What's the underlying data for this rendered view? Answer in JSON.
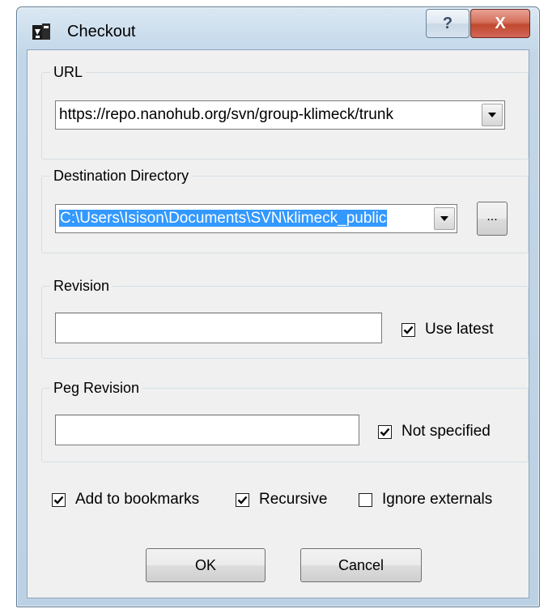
{
  "window": {
    "title": "Checkout",
    "help_label": "?",
    "close_label": "X"
  },
  "url_group": {
    "legend": "URL",
    "value": "https://repo.nanohub.org/svn/group-klimeck/trunk"
  },
  "destination_group": {
    "legend": "Destination Directory",
    "value": "C:\\Users\\Isison\\Documents\\SVN\\klimeck_public",
    "browse_label": "..."
  },
  "revision_group": {
    "legend": "Revision",
    "value": "",
    "use_latest_label": "Use latest",
    "use_latest_checked": true
  },
  "peg_revision_group": {
    "legend": "Peg Revision",
    "value": "",
    "not_specified_label": "Not specified",
    "not_specified_checked": true
  },
  "options": {
    "add_to_bookmarks_label": "Add to bookmarks",
    "add_to_bookmarks_checked": true,
    "recursive_label": "Recursive",
    "recursive_checked": true,
    "ignore_externals_label": "Ignore externals",
    "ignore_externals_checked": false
  },
  "buttons": {
    "ok_label": "OK",
    "cancel_label": "Cancel"
  },
  "colors": {
    "selection": "#3399ff",
    "close_button": "#c0482f"
  }
}
